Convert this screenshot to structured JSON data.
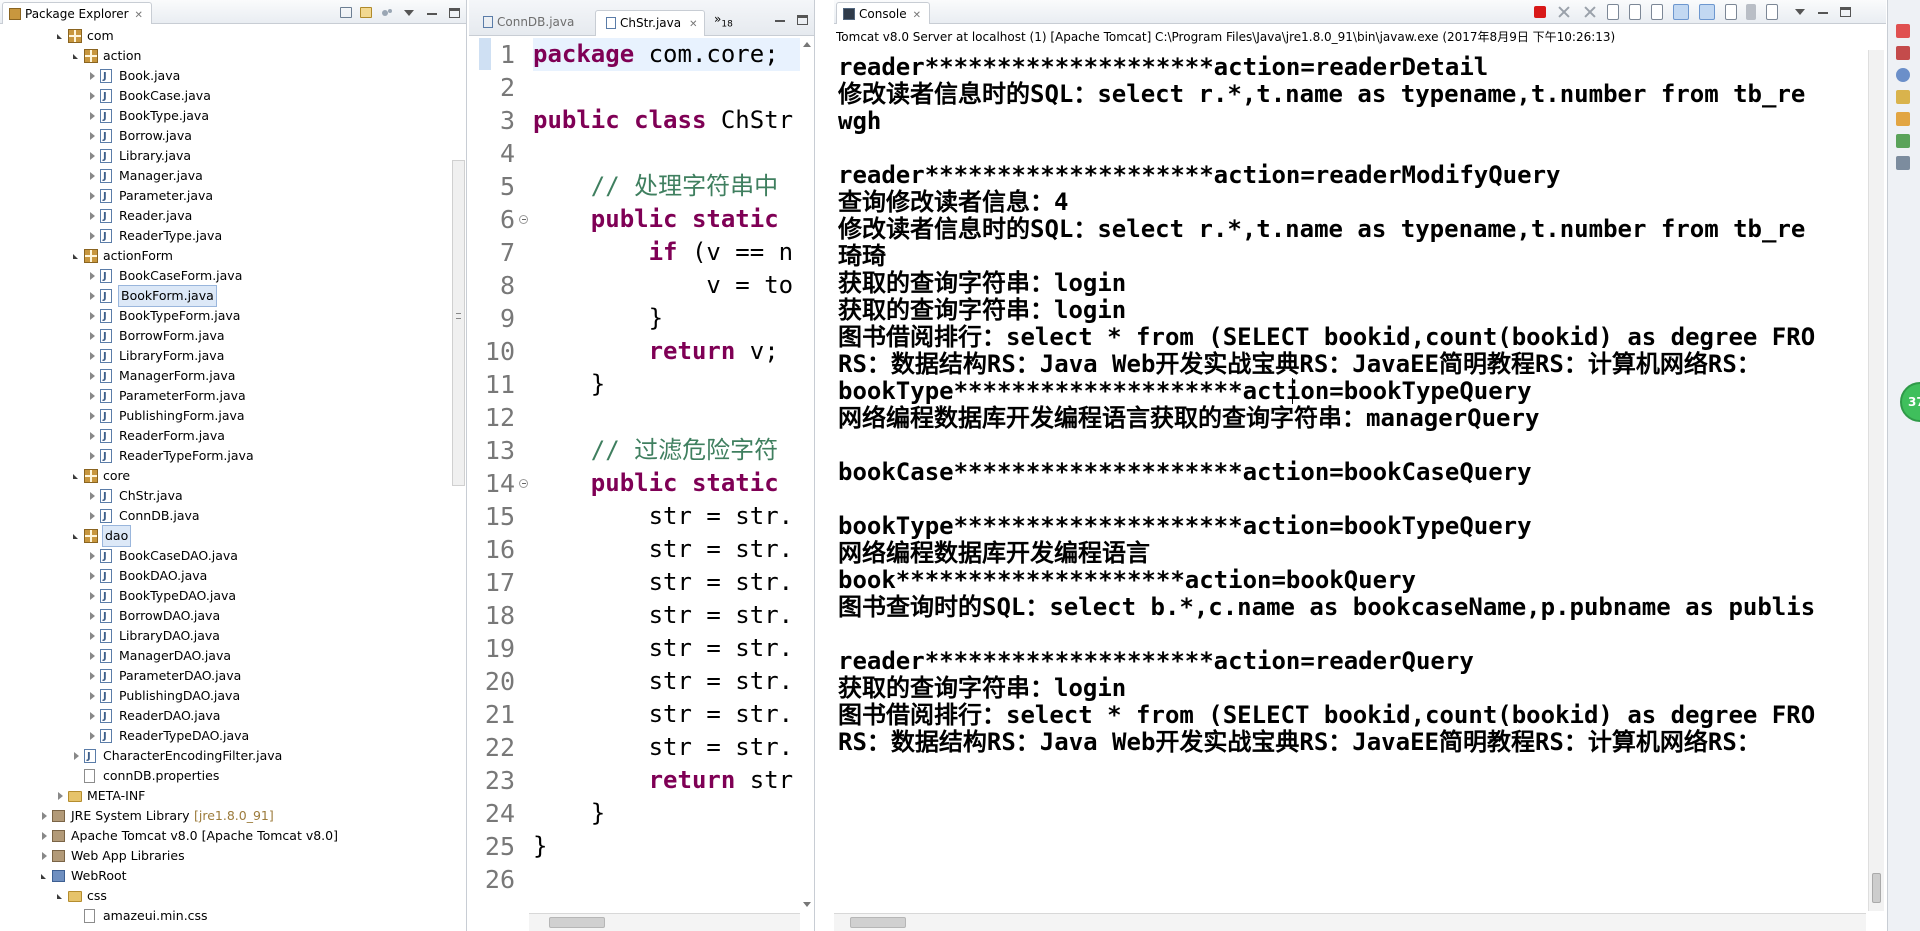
{
  "package_explorer": {
    "title": "Package Explorer",
    "tree": [
      {
        "label": "com",
        "kind": "pkg",
        "depth": 0,
        "state": "open"
      },
      {
        "label": "action",
        "kind": "pkg",
        "depth": 1,
        "state": "open"
      },
      {
        "label": "Book.java",
        "kind": "java",
        "depth": 2,
        "state": "closed"
      },
      {
        "label": "BookCase.java",
        "kind": "java",
        "depth": 2,
        "state": "closed"
      },
      {
        "label": "BookType.java",
        "kind": "java",
        "depth": 2,
        "state": "closed"
      },
      {
        "label": "Borrow.java",
        "kind": "java",
        "depth": 2,
        "state": "closed"
      },
      {
        "label": "Library.java",
        "kind": "java",
        "depth": 2,
        "state": "closed"
      },
      {
        "label": "Manager.java",
        "kind": "java",
        "depth": 2,
        "state": "closed"
      },
      {
        "label": "Parameter.java",
        "kind": "java",
        "depth": 2,
        "state": "closed"
      },
      {
        "label": "Reader.java",
        "kind": "java",
        "depth": 2,
        "state": "closed"
      },
      {
        "label": "ReaderType.java",
        "kind": "java",
        "depth": 2,
        "state": "closed"
      },
      {
        "label": "actionForm",
        "kind": "pkg",
        "depth": 1,
        "state": "open"
      },
      {
        "label": "BookCaseForm.java",
        "kind": "java",
        "depth": 2,
        "state": "closed"
      },
      {
        "label": "BookForm.java",
        "kind": "java",
        "depth": 2,
        "state": "closed",
        "selected": true
      },
      {
        "label": "BookTypeForm.java",
        "kind": "java",
        "depth": 2,
        "state": "closed"
      },
      {
        "label": "BorrowForm.java",
        "kind": "java",
        "depth": 2,
        "state": "closed"
      },
      {
        "label": "LibraryForm.java",
        "kind": "java",
        "depth": 2,
        "state": "closed"
      },
      {
        "label": "ManagerForm.java",
        "kind": "java",
        "depth": 2,
        "state": "closed"
      },
      {
        "label": "ParameterForm.java",
        "kind": "java",
        "depth": 2,
        "state": "closed"
      },
      {
        "label": "PublishingForm.java",
        "kind": "java",
        "depth": 2,
        "state": "closed"
      },
      {
        "label": "ReaderForm.java",
        "kind": "java",
        "depth": 2,
        "state": "closed"
      },
      {
        "label": "ReaderTypeForm.java",
        "kind": "java",
        "depth": 2,
        "state": "closed"
      },
      {
        "label": "core",
        "kind": "pkg",
        "depth": 1,
        "state": "open"
      },
      {
        "label": "ChStr.java",
        "kind": "java",
        "depth": 2,
        "state": "closed"
      },
      {
        "label": "ConnDB.java",
        "kind": "java",
        "depth": 2,
        "state": "closed"
      },
      {
        "label": "dao",
        "kind": "pkg",
        "depth": 1,
        "state": "open",
        "selected": true
      },
      {
        "label": "BookCaseDAO.java",
        "kind": "java",
        "depth": 2,
        "state": "closed"
      },
      {
        "label": "BookDAO.java",
        "kind": "java",
        "depth": 2,
        "state": "closed"
      },
      {
        "label": "BookTypeDAO.java",
        "kind": "java",
        "depth": 2,
        "state": "closed"
      },
      {
        "label": "BorrowDAO.java",
        "kind": "java",
        "depth": 2,
        "state": "closed"
      },
      {
        "label": "LibraryDAO.java",
        "kind": "java",
        "depth": 2,
        "state": "closed"
      },
      {
        "label": "ManagerDAO.java",
        "kind": "java",
        "depth": 2,
        "state": "closed"
      },
      {
        "label": "ParameterDAO.java",
        "kind": "java",
        "depth": 2,
        "state": "closed"
      },
      {
        "label": "PublishingDAO.java",
        "kind": "java",
        "depth": 2,
        "state": "closed"
      },
      {
        "label": "ReaderDAO.java",
        "kind": "java",
        "depth": 2,
        "state": "closed"
      },
      {
        "label": "ReaderTypeDAO.java",
        "kind": "java",
        "depth": 2,
        "state": "closed"
      },
      {
        "label": "CharacterEncodingFilter.java",
        "kind": "java",
        "depth": 1,
        "state": "closed"
      },
      {
        "label": "connDB.properties",
        "kind": "file",
        "depth": 1,
        "state": "none"
      },
      {
        "label": "META-INF",
        "kind": "folder",
        "depth": 0,
        "state": "closed"
      },
      {
        "label": "JRE System Library",
        "suffix": "[jre1.8.0_91]",
        "kind": "lib",
        "depth": -1,
        "state": "closed"
      },
      {
        "label": "Apache Tomcat v8.0 [Apache Tomcat v8.0]",
        "kind": "lib",
        "depth": -1,
        "state": "closed"
      },
      {
        "label": "Web App Libraries",
        "kind": "lib",
        "depth": -1,
        "state": "closed"
      },
      {
        "label": "WebRoot",
        "kind": "web",
        "depth": -1,
        "state": "open"
      },
      {
        "label": "css",
        "kind": "folder",
        "depth": 0,
        "state": "open"
      },
      {
        "label": "amazeui.min.css",
        "kind": "file",
        "depth": 1,
        "state": "none"
      }
    ]
  },
  "editor": {
    "tabs": [
      {
        "label": "ConnDB.java",
        "active": false
      },
      {
        "label": "ChStr.java",
        "active": true
      }
    ],
    "overflow_label": "»",
    "overflow_count": "18",
    "line_numbers": [
      "1",
      "2",
      "3",
      "4",
      "5",
      "6",
      "7",
      "8",
      "9",
      "10",
      "11",
      "12",
      "13",
      "14",
      "15",
      "16",
      "17",
      "18",
      "19",
      "20",
      "21",
      "22",
      "23",
      "24",
      "25",
      "26"
    ],
    "lines": [
      "package com.core;",
      "",
      "public class ChStr",
      "",
      "    // 处理字符串中",
      "    public static",
      "        if (v == n",
      "            v = to",
      "        }",
      "        return v;",
      "    }",
      "",
      "    // 过滤危险字符",
      "    public static",
      "        str = str.",
      "        str = str.",
      "        str = str.",
      "        str = str.",
      "        str = str.",
      "        str = str.",
      "        str = str.",
      "        str = str.",
      "        return str",
      "    }",
      "}",
      ""
    ]
  },
  "console": {
    "title": "Console",
    "launch_info": "Tomcat v8.0 Server at localhost (1) [Apache Tomcat] C:\\Program Files\\Java\\jre1.8.0_91\\bin\\javaw.exe (2017年8月9日 下午10:26:13)",
    "lines": [
      "reader********************action=readerDetail",
      "修改读者信息时的SQL：select r.*,t.name as typename,t.number from tb_re",
      "wgh",
      "",
      "reader********************action=readerModifyQuery",
      "查询修改读者信息：4",
      "修改读者信息时的SQL：select r.*,t.name as typename,t.number from tb_re",
      "琦琦",
      "获取的查询字符串：login",
      "获取的查询字符串：login",
      "图书借阅排行：select * from (SELECT bookid,count(bookid) as degree FRO",
      "RS：数据结构RS：Java Web开发实战宝典RS：JavaEE简明教程RS：计算机网络RS：",
      "bookType********************action=bookTypeQuery",
      "网络编程数据库开发编程语言获取的查询字符串：managerQuery",
      "",
      "bookCase********************action=bookCaseQuery",
      "",
      "bookType********************action=bookTypeQuery",
      "网络编程数据库开发编程语言",
      "book********************action=bookQuery",
      "图书查询时的SQL：select b.*,c.name as bookcaseName,p.pubname as publis",
      "",
      "reader********************action=readerQuery",
      "获取的查询字符串：login",
      "图书借阅排行：select * from (SELECT bookid,count(bookid) as degree FRO",
      "RS：数据结构RS：Java Web开发实战宝典RS：JavaEE简明教程RS：计算机网络RS："
    ]
  },
  "badge": {
    "value": "37"
  },
  "colors": {
    "keyword": "#7f0055",
    "comment": "#3f7f5f",
    "terminate": "#d81818",
    "badge": "#3fbf5c"
  }
}
